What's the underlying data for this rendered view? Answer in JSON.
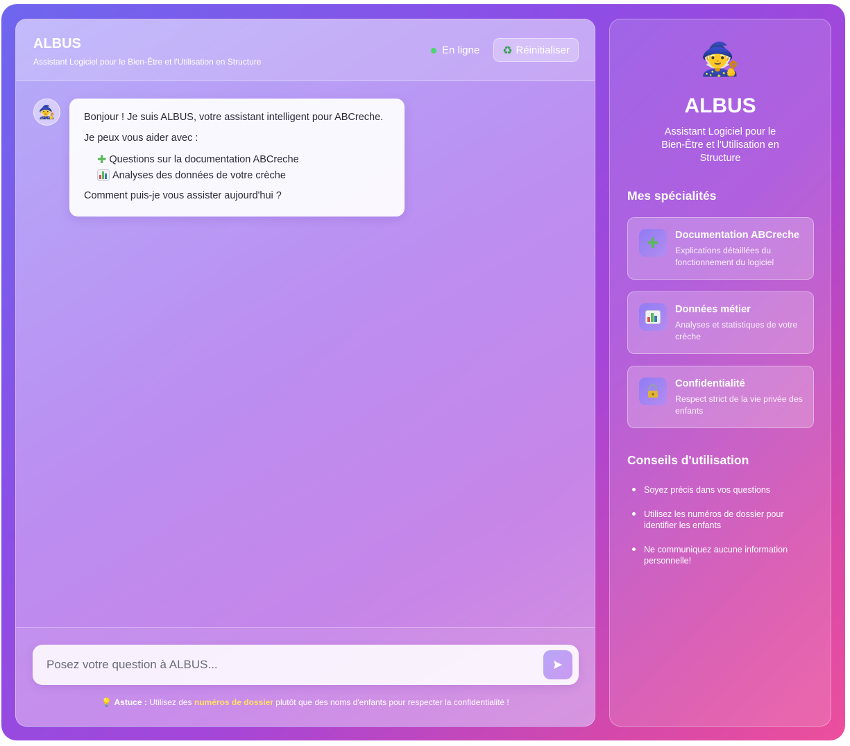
{
  "header": {
    "title": "ALBUS",
    "subtitle": "Assistant Logiciel pour le Bien-Être et l'Utilisation en Structure",
    "status": "En ligne",
    "reset_label": "Réinitialiser",
    "reset_icon": "recycle-icon"
  },
  "message": {
    "avatar": "🧙",
    "greeting": "Bonjour ! Je suis ALBUS, votre assistant intelligent pour ABCreche.",
    "intro": "Je peux vous aider avec :",
    "items": [
      {
        "icon": "puzzle-icon",
        "text": "Questions sur la documentation ABCreche"
      },
      {
        "icon": "bar-chart-icon",
        "text": "Analyses des données de votre crèche"
      }
    ],
    "closing": "Comment puis-je vous assister aujourd'hui ?"
  },
  "input": {
    "placeholder": "Posez votre question à ALBUS...",
    "send_icon": "send-icon"
  },
  "tip": {
    "icon": "💡",
    "label": "Astuce :",
    "before": " Utilisez des ",
    "highlight": "numéros de dossier",
    "after": " plutôt que des noms d'enfants pour respecter la confidentialité !"
  },
  "sidebar": {
    "logo": "🧙",
    "title": "ALBUS",
    "subtitle": "Assistant Logiciel pour le Bien-Être et l'Utilisation en Structure",
    "specialties_title": "Mes spécialités",
    "specialties": [
      {
        "icon": "puzzle-icon",
        "title": "Documentation ABCreche",
        "desc": "Explications détaillées du fonctionnement du logiciel"
      },
      {
        "icon": "bar-chart-icon",
        "title": "Données métier",
        "desc": "Analyses et statistiques de votre crèche"
      },
      {
        "icon": "lock-icon",
        "title": "Confidentialité",
        "desc": "Respect strict de la vie privée des enfants"
      }
    ],
    "tips_title": "Conseils d'utilisation",
    "tips": [
      "Soyez précis dans vos questions",
      "Utilisez les numéros de dossier pour identifier les enfants",
      "Ne communiquez aucune information personnelle!"
    ]
  },
  "colors": {
    "status_dot": "#4ad66d",
    "highlight": "#ffe066",
    "accent": "#8b4ee6"
  }
}
